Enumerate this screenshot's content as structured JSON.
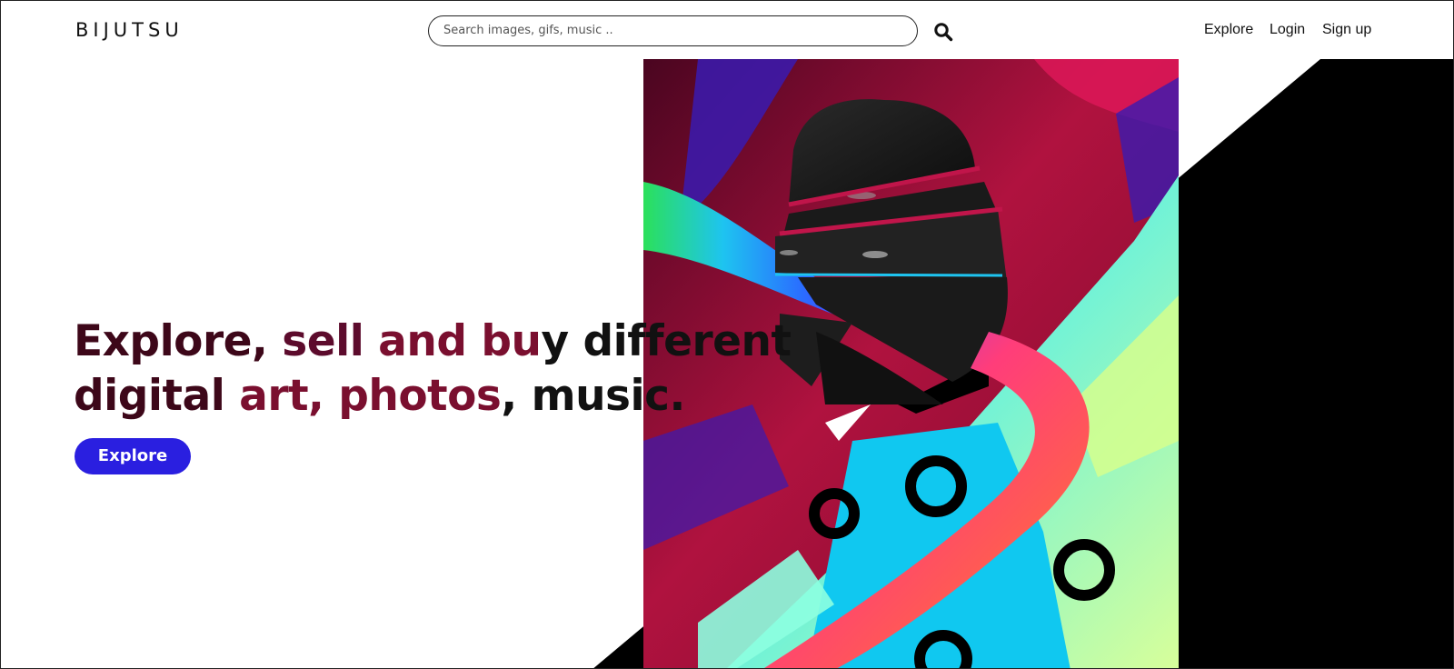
{
  "header": {
    "logo": "BIJUTSU",
    "search": {
      "placeholder": "Search images, gifs, music .."
    },
    "nav": {
      "explore": "Explore",
      "login": "Login",
      "signup": "Sign up"
    }
  },
  "hero": {
    "headline": {
      "line1": {
        "part1": "Explore,",
        "part2": " sell",
        "part3": " and bu",
        "part4": "y different"
      },
      "line2": {
        "part1": "digital",
        "part2": " art, photos",
        "part3": ", music."
      }
    },
    "cta_label": "Explore"
  },
  "colors": {
    "accent_button": "#2a1fe0",
    "headline_dark": "#3d0719",
    "headline_mid": "#7a0f2f",
    "text": "#111111"
  },
  "icons": {
    "search": "magnifier-icon"
  }
}
